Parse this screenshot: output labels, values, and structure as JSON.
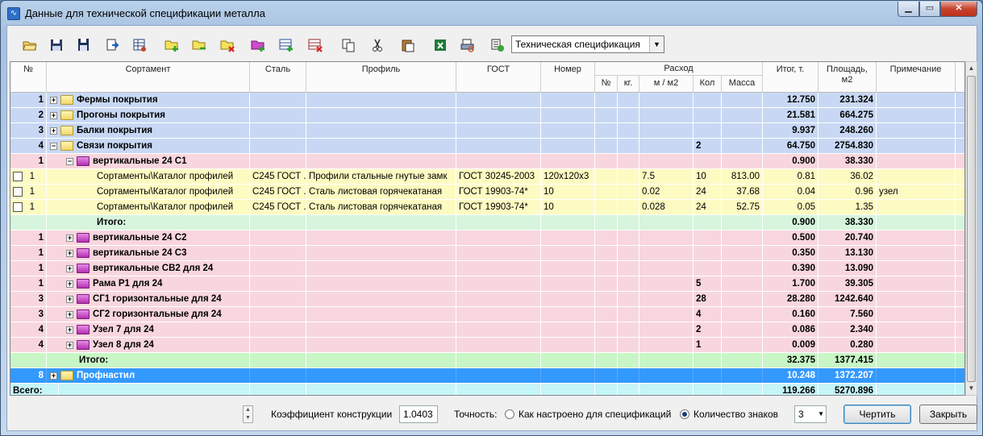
{
  "window": {
    "title": "Данные для технической спецификации металла",
    "app_icon": "chart-app-icon"
  },
  "toolbar": {
    "icons": [
      "open-folder-icon",
      "save-icon",
      "save-as-icon",
      "export-icon",
      "table-settings-icon",
      "add-folder-icon",
      "open-folder-arrow-icon",
      "delete-folder-icon",
      "add-group-icon",
      "add-row-icon",
      "delete-row-icon",
      "copy-icon",
      "cut-icon",
      "paste-icon",
      "excel-icon",
      "print-preview-icon",
      "calculator-icon"
    ],
    "spec_type": "Техническая спецификация"
  },
  "header": {
    "num": "№",
    "sortament": "Сортамент",
    "steel": "Сталь",
    "profile": "Профиль",
    "gost": "ГОСТ",
    "nomer": "Номер",
    "rashod": "Расход",
    "r_num": "№",
    "r_kg": "кг.",
    "r_mm2": "м / м2",
    "r_kol": "Кол",
    "r_massa": "Масса",
    "itog": "Итог, т.",
    "area": "Площадь,\nм2",
    "note": "Примечание"
  },
  "rows": [
    {
      "num": "1",
      "label": "Фермы покрытия",
      "itog": "12.750",
      "area": "231.324",
      "type": "group",
      "exp": "+"
    },
    {
      "num": "2",
      "label": "Прогоны покрытия",
      "itog": "21.581",
      "area": "664.275",
      "type": "group",
      "exp": "+"
    },
    {
      "num": "3",
      "label": "Балки покрытия",
      "itog": "9.937",
      "area": "248.260",
      "type": "group",
      "exp": "+"
    },
    {
      "num": "4",
      "label": "Связи покрытия",
      "kol": "2",
      "itog": "64.750",
      "area": "2754.830",
      "type": "group",
      "exp": "−"
    },
    {
      "num": "1",
      "label": "вертикальные 24 С1",
      "itog": "0.900",
      "area": "38.330",
      "type": "sub",
      "exp": "−"
    },
    {
      "num": "1",
      "sortament": "Сортаменты\\Каталог профилей",
      "steel": "С245 ГОСТ .",
      "profile": "Профили стальные гнутые замк",
      "gost": "ГОСТ 30245-2003",
      "nomer": "120x120x3",
      "rnum": "",
      "kg": "",
      "mm2": "7.5",
      "kol": "10",
      "massa": "813.00",
      "itog": "0.81",
      "area": "36.02",
      "note": "",
      "type": "item"
    },
    {
      "num": "1",
      "sortament": "Сортаменты\\Каталог профилей",
      "steel": "С245 ГОСТ .",
      "profile": "Сталь листовая горячекатаная",
      "gost": "ГОСТ 19903-74*",
      "nomer": "10",
      "rnum": "",
      "kg": "",
      "mm2": "0.02",
      "kol": "24",
      "massa": "37.68",
      "itog": "0.04",
      "area": "0.96",
      "note": "узел",
      "type": "item"
    },
    {
      "num": "1",
      "sortament": "Сортаменты\\Каталог профилей",
      "steel": "С245 ГОСТ .",
      "profile": "Сталь листовая горячекатаная",
      "gost": "ГОСТ 19903-74*",
      "nomer": "10",
      "rnum": "",
      "kg": "",
      "mm2": "0.028",
      "kol": "24",
      "massa": "52.75",
      "itog": "0.05",
      "area": "1.35",
      "note": "",
      "type": "item"
    },
    {
      "num": "",
      "label": "Итого:",
      "itog": "0.900",
      "area": "38.330",
      "type": "subtotal"
    },
    {
      "num": "1",
      "label": "вертикальные 24 С2",
      "itog": "0.500",
      "area": "20.740",
      "type": "sub",
      "exp": "+"
    },
    {
      "num": "1",
      "label": "вертикальные 24 С3",
      "itog": "0.350",
      "area": "13.130",
      "type": "sub",
      "exp": "+"
    },
    {
      "num": "1",
      "label": "вертикальные СВ2 для 24",
      "itog": "0.390",
      "area": "13.090",
      "type": "sub",
      "exp": "+"
    },
    {
      "num": "1",
      "label": "Рама Р1 для 24",
      "kol": "5",
      "itog": "1.700",
      "area": "39.305",
      "type": "sub",
      "exp": "+"
    },
    {
      "num": "3",
      "label": "СГ1 горизонтальные для 24",
      "kol": "28",
      "itog": "28.280",
      "area": "1242.640",
      "type": "sub",
      "exp": "+"
    },
    {
      "num": "3",
      "label": "СГ2 горизонтальные для 24",
      "kol": "4",
      "itog": "0.160",
      "area": "7.560",
      "type": "sub",
      "exp": "+"
    },
    {
      "num": "4",
      "label": "Узел 7 для 24",
      "kol": "2",
      "itog": "0.086",
      "area": "2.340",
      "type": "sub",
      "exp": "+"
    },
    {
      "num": "4",
      "label": "Узел 8 для 24",
      "kol": "1",
      "itog": "0.009",
      "area": "0.280",
      "type": "sub",
      "exp": "+"
    },
    {
      "num": "",
      "label": "Итого:",
      "itog": "32.375",
      "area": "1377.415",
      "type": "total2"
    },
    {
      "num": "8",
      "label": "Профнастил",
      "itog": "10.248",
      "area": "1372.207",
      "type": "selected",
      "exp": "+"
    },
    {
      "num": "Всего:",
      "label": "",
      "itog": "119.266",
      "area": "5270.896",
      "type": "grand"
    }
  ],
  "bottom": {
    "coef_label": "Коэффициент конструкции",
    "coef_value": "1.0403",
    "precision_label": "Точность:",
    "radio1": "Как настроено для спецификаций",
    "radio2": "Количество знаков",
    "digits": "3",
    "draw_btn": "Чертить",
    "close_btn": "Закрыть"
  },
  "colors": {
    "group": "#c8d8f4",
    "sub": "#f8d6de",
    "item": "#fdfbc2",
    "subtotal": "#d6f5dc",
    "total2": "#c8f6c6",
    "selected": "#3399ff",
    "grand": "#c6f5f8"
  }
}
